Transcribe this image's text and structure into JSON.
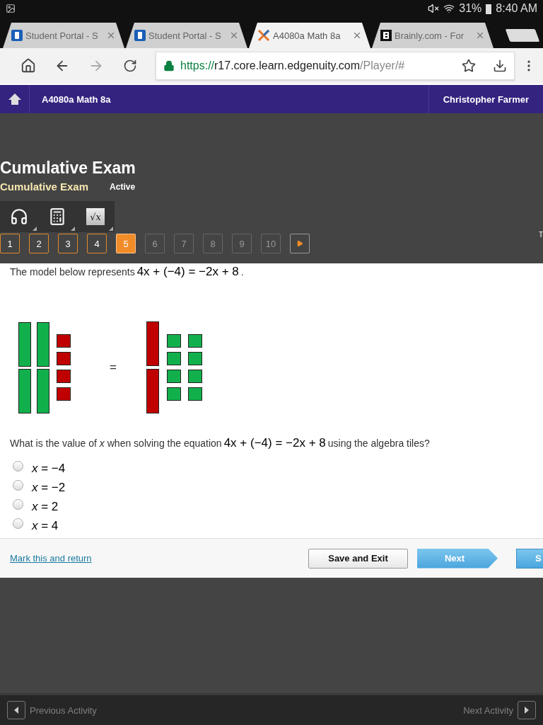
{
  "status_bar": {
    "battery": "31%",
    "time": "8:40 AM"
  },
  "browser_tabs": [
    {
      "title": "Student Portal - S",
      "kind": "portal",
      "selected": false
    },
    {
      "title": "Student Portal - S",
      "kind": "portal",
      "selected": false
    },
    {
      "title": "A4080a Math 8a",
      "kind": "cross",
      "selected": true
    },
    {
      "title": "Brainly.com - For",
      "kind": "brainly",
      "selected": false
    }
  ],
  "address_bar": {
    "scheme": "https://",
    "host": "r17.core.learn.edgenuity.com",
    "path": "/Player/#"
  },
  "header": {
    "course": "A4080a Math 8a",
    "user": "Christopher Farmer"
  },
  "activity": {
    "title": "Cumulative Exam",
    "subtitle": "Cumulative Exam",
    "status": "Active"
  },
  "tools": [
    {
      "kind": "audio"
    },
    {
      "kind": "calculator"
    },
    {
      "kind": "formula",
      "label": "√x"
    }
  ],
  "question_nav": [
    {
      "label": "1",
      "selected": false,
      "disabled": false
    },
    {
      "label": "2",
      "selected": false,
      "disabled": false
    },
    {
      "label": "3",
      "selected": false,
      "disabled": false
    },
    {
      "label": "4",
      "selected": false,
      "disabled": false
    },
    {
      "label": "5",
      "selected": true,
      "disabled": false
    },
    {
      "label": "6",
      "selected": false,
      "disabled": true
    },
    {
      "label": "7",
      "selected": false,
      "disabled": true
    },
    {
      "label": "8",
      "selected": false,
      "disabled": true
    },
    {
      "label": "9",
      "selected": false,
      "disabled": true
    },
    {
      "label": "10",
      "selected": false,
      "disabled": true
    }
  ],
  "nav_edge_text": "T",
  "prompt": {
    "lead": "The model below represents",
    "equation": "4x + (−4) = −2x + 8",
    "end": "."
  },
  "model": {
    "left": [
      {
        "kind": "x",
        "color": "#12b04c"
      },
      {
        "kind": "x",
        "color": "#12b04c"
      },
      {
        "kind": "x",
        "color": "#12b04c"
      },
      {
        "kind": "x",
        "color": "#12b04c"
      },
      {
        "kind": "unit",
        "color": "#c00000"
      },
      {
        "kind": "unit",
        "color": "#c00000"
      },
      {
        "kind": "unit",
        "color": "#c00000"
      },
      {
        "kind": "unit",
        "color": "#c00000"
      }
    ],
    "equals": "=",
    "right": [
      {
        "kind": "x",
        "color": "#c00000"
      },
      {
        "kind": "x",
        "color": "#c00000"
      },
      {
        "kind": "unit",
        "color": "#12b04c"
      },
      {
        "kind": "unit",
        "color": "#12b04c"
      },
      {
        "kind": "unit",
        "color": "#12b04c"
      },
      {
        "kind": "unit",
        "color": "#12b04c"
      },
      {
        "kind": "unit",
        "color": "#12b04c"
      },
      {
        "kind": "unit",
        "color": "#12b04c"
      },
      {
        "kind": "unit",
        "color": "#12b04c"
      },
      {
        "kind": "unit",
        "color": "#12b04c"
      }
    ]
  },
  "question": {
    "lead": "What is the value of *x* when solving the equation",
    "equation": "4x + (−4) = −2x + 8",
    "end": "using the algebra tiles?"
  },
  "options": [
    {
      "label": "*x* = −4",
      "selected": false
    },
    {
      "label": "*x* = −2",
      "selected": false
    },
    {
      "label": "*x* = 2",
      "selected": false
    },
    {
      "label": "*x* = 4",
      "selected": false
    }
  ],
  "footer": {
    "link": "Mark this and return",
    "save": "Save and Exit",
    "next": "Next",
    "cut_button": "S"
  },
  "bottom_nav": {
    "previous": "Previous Activity",
    "next": "Next Activity"
  }
}
